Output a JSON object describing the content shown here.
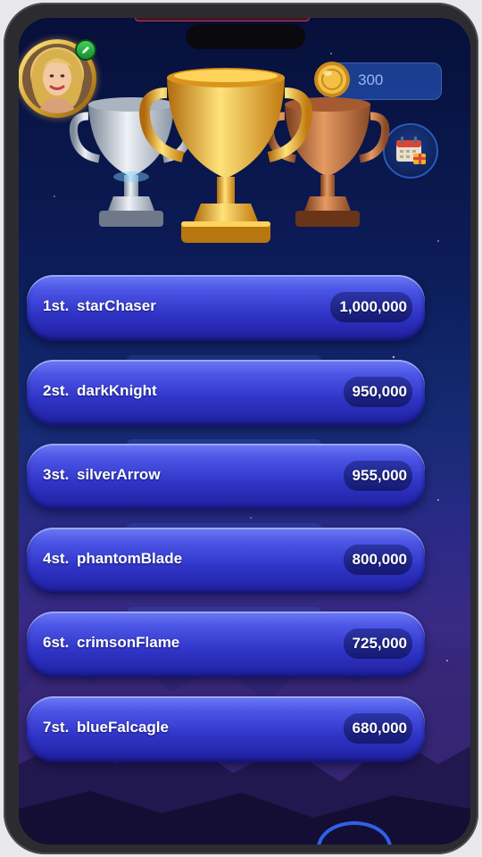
{
  "header": {
    "coins": "300",
    "avatar_icon": "player-avatar",
    "edit_icon": "pencil-icon",
    "coin_icon": "gold-coin-icon",
    "calendar_icon": "calendar-gift-icon"
  },
  "podium": {
    "first": "gold-trophy",
    "second": "silver-trophy",
    "third": "bronze-trophy"
  },
  "leaderboard": [
    {
      "rank": "1st.",
      "name": "starChaser",
      "score": "1,000,000"
    },
    {
      "rank": "2st.",
      "name": "darkKnight",
      "score": "950,000"
    },
    {
      "rank": "3st.",
      "name": "silverArrow",
      "score": "955,000"
    },
    {
      "rank": "4st.",
      "name": "phantomBlade",
      "score": "800,000"
    },
    {
      "rank": "6st.",
      "name": "crimsonFlame",
      "score": "725,000"
    },
    {
      "rank": "7st.",
      "name": "blueFalcagle",
      "score": "680,000"
    }
  ],
  "colors": {
    "row_blue": "#3138c8",
    "background_navy": "#0c1c58",
    "gold": "#e8a82a",
    "silver": "#b8c4d4",
    "bronze": "#b0683a"
  }
}
